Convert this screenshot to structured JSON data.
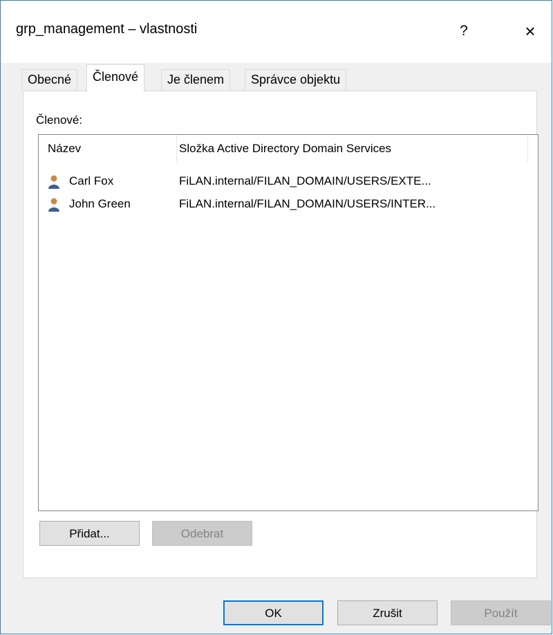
{
  "window": {
    "title": "grp_management – vlastnosti",
    "help_label": "?",
    "close_label": "×"
  },
  "tabs": [
    {
      "label": "Obecné",
      "active": false
    },
    {
      "label": "Členové",
      "active": true
    },
    {
      "label": "Je členem",
      "active": false
    },
    {
      "label": "Správce objektu",
      "active": false
    }
  ],
  "members": {
    "label": "Členové:",
    "columns": [
      "Název",
      "Složka Active Directory Domain Services"
    ],
    "rows": [
      {
        "icon": "user-icon",
        "name": "Carl Fox",
        "path": "FiLAN.internal/FILAN_DOMAIN/USERS/EXTE..."
      },
      {
        "icon": "user-icon",
        "name": "John Green",
        "path": "FiLAN.internal/FILAN_DOMAIN/USERS/INTER..."
      }
    ]
  },
  "buttons": {
    "add": "Přidat...",
    "remove": "Odebrat",
    "ok": "OK",
    "cancel": "Zrušit",
    "apply": "Použít"
  },
  "colors": {
    "accent": "#0078d7",
    "window_border": "#3c7fb1",
    "dialog_bg": "#f0f0f0"
  }
}
